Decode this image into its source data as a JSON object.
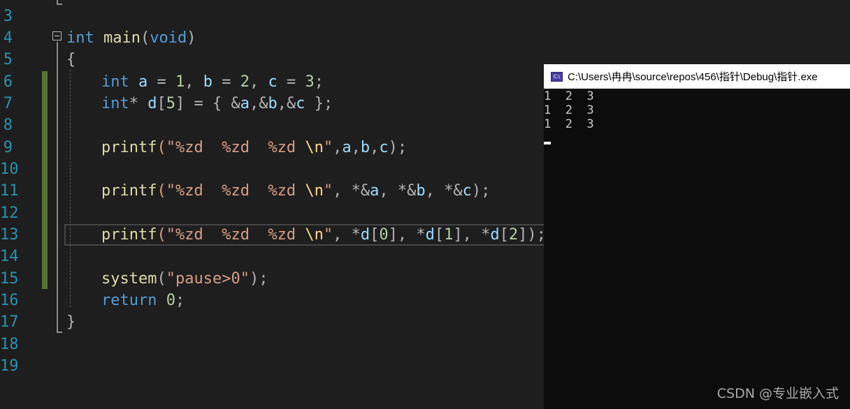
{
  "editor": {
    "line_numbers": [
      "3",
      "4",
      "5",
      "6",
      "7",
      "8",
      "9",
      "10",
      "11",
      "12",
      "13",
      "14",
      "15",
      "16",
      "17",
      "18",
      "19"
    ],
    "code": {
      "l4_int": "int",
      "l4_main": "main",
      "l4_paren_open": "(",
      "l4_void": "void",
      "l4_paren_close": ")",
      "l5_brace": "{",
      "l6_int": "int",
      "l6_rest_a": "a",
      "l6_eq1": " = ",
      "l6_n1": "1",
      "l6_c1": ", ",
      "l6_b": "b",
      "l6_eq2": " = ",
      "l6_n2": "2",
      "l6_c2": ", ",
      "l6_c": "c",
      "l6_eq3": " = ",
      "l6_n3": "3",
      "l6_semi": ";",
      "l7_int": "int",
      "l7_star": "*",
      "l7_d": "d",
      "l7_b1": "[",
      "l7_n5": "5",
      "l7_b2": "]",
      "l7_eq": " = { ",
      "l7_amp1": "&",
      "l7_a": "a",
      "l7_cm1": ",",
      "l7_amp2": "&",
      "l7_b": "b",
      "l7_cm2": ",",
      "l7_amp3": "&",
      "l7_c": "c",
      "l7_end": " };",
      "printf": "printf",
      "fmt_open": "(\"%zd  %zd  %zd ",
      "esc_n": "\\n",
      "fmt_close": "\"",
      "l9_args_1": ",",
      "l9_a": "a",
      "l9_cm1": ",",
      "l9_b": "b",
      "l9_cm2": ",",
      "l9_c": "c",
      "l9_end": ");",
      "l11_args": ", *&",
      "l11_a": "a",
      "l11_sep1": ", *&",
      "l11_b": "b",
      "l11_sep2": ", *&",
      "l11_c": "c",
      "l11_end": ");",
      "l13_s1": ", *",
      "l13_d1": "d",
      "l13_o1": "[",
      "l13_n0": "0",
      "l13_c1": "]",
      "l13_s2": ", *",
      "l13_d2": "d",
      "l13_o2": "[",
      "l13_n1": "1",
      "l13_c2": "]",
      "l13_s3": ", *",
      "l13_d3": "d",
      "l13_o3": "[",
      "l13_n2": "2",
      "l13_c3": "]",
      "l13_end": ");",
      "l15_system": "system",
      "l15_open": "(",
      "l15_str": "\"pause>0\"",
      "l15_end": ");",
      "l16_return": "return",
      "l16_zero": "0",
      "l16_semi": ";",
      "l17_brace": "}"
    }
  },
  "console": {
    "title": "C:\\Users\\冉冉\\source\\repos\\456\\指针\\Debug\\指针.exe",
    "icon": "console-app-icon",
    "icon_text": "C:\\",
    "output": [
      "1  2  3",
      "1  2  3",
      "1  2  3"
    ],
    "background": "#0c0c0c"
  },
  "watermark": "CSDN @专业嵌入式",
  "colors": {
    "keyword": "#569cd6",
    "function": "#dcdcaa",
    "string": "#d69d85",
    "number": "#b5cea8",
    "identifier": "#9cdcfe",
    "line_number": "#2b91af",
    "change_bar": "#577430"
  }
}
